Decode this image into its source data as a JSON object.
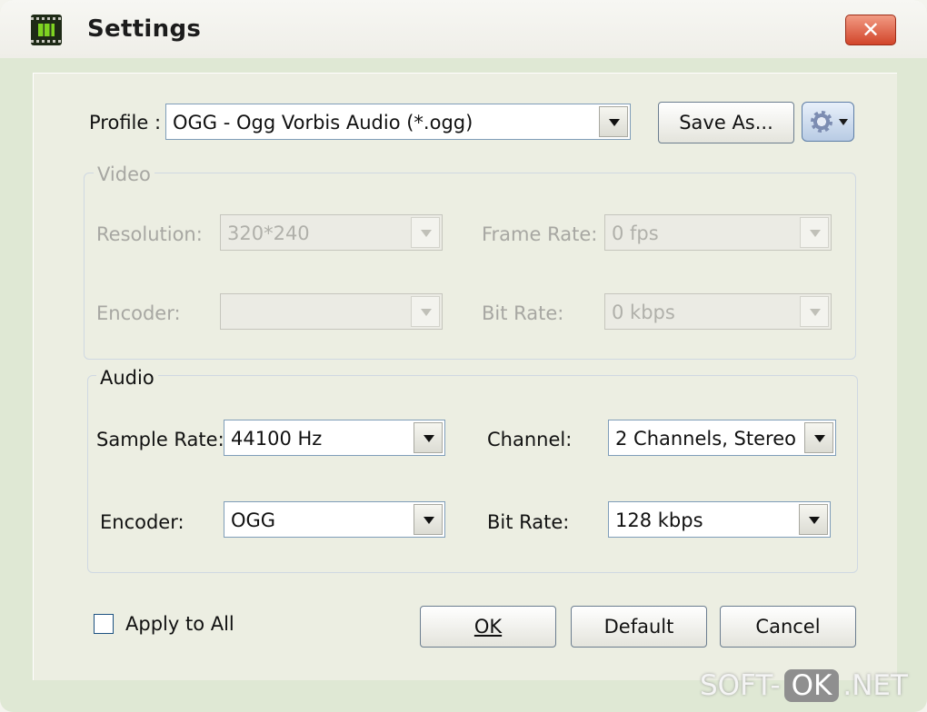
{
  "window": {
    "title": "Settings",
    "close_label": "✕"
  },
  "profile": {
    "label": "Profile :",
    "value": "OGG - Ogg Vorbis Audio (*.ogg)",
    "save_as_label": "Save As...",
    "gear_icon": "gear-icon"
  },
  "video": {
    "legend": "Video",
    "resolution_label": "Resolution:",
    "resolution_value": "320*240",
    "frame_rate_label": "Frame Rate:",
    "frame_rate_value": "0 fps",
    "encoder_label": "Encoder:",
    "encoder_value": "",
    "bit_rate_label": "Bit Rate:",
    "bit_rate_value": "0 kbps"
  },
  "audio": {
    "legend": "Audio",
    "sample_rate_label": "Sample Rate:",
    "sample_rate_value": "44100 Hz",
    "channel_label": "Channel:",
    "channel_value": "2 Channels, Stereo",
    "encoder_label": "Encoder:",
    "encoder_value": "OGG",
    "bit_rate_label": "Bit Rate:",
    "bit_rate_value": "128 kbps"
  },
  "footer": {
    "apply_all_label": "Apply to All",
    "apply_all_checked": false,
    "ok_label": "OK",
    "default_label": "Default",
    "cancel_label": "Cancel"
  },
  "watermark": {
    "left": "SOFT-",
    "ok": "OK",
    "right": ".NET"
  }
}
